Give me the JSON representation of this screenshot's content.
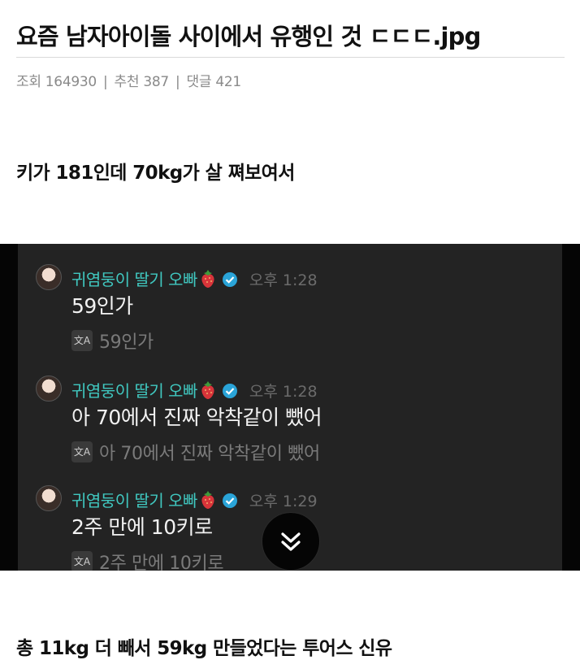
{
  "post": {
    "title": "요즘 남자아이돌 사이에서 유행인 것 ㄷㄷㄷ.jpg",
    "views_label": "조회 164930",
    "likes_label": "추천 387",
    "comments_label": "댓글 421",
    "separator": "|",
    "paragraph1": "키가 181인데 70kg가 살 쪄보여서",
    "paragraph2": "총 11kg 더 빼서 59kg 만들었다는 투어스 신유"
  },
  "chat": {
    "messages": [
      {
        "name": "귀염둥이 딸기 오빠",
        "time": "오후 1:28",
        "text": "59인가",
        "translation": "59인가"
      },
      {
        "name": "귀염둥이 딸기 오빠",
        "time": "오후 1:28",
        "text": "아 70에서 진짜 악착같이 뺐어",
        "translation": "아 70에서 진짜 악착같이 뺐어"
      },
      {
        "name": "귀염둥이 딸기 오빠",
        "time": "오후 1:29",
        "text": "2주 만에 10키로",
        "translation": "2주 만에 10키로"
      }
    ],
    "translate_icon_glyph": "文A",
    "icons": {
      "avatar": "avatar-icon",
      "strawberry": "strawberry-emoji-icon",
      "verified": "verified-badge-icon",
      "translate": "translate-icon",
      "scroll_down": "double-chevron-down-icon"
    },
    "colors": {
      "name": "#40c8c0",
      "background": "#232323",
      "time": "#6b6b6b"
    }
  }
}
